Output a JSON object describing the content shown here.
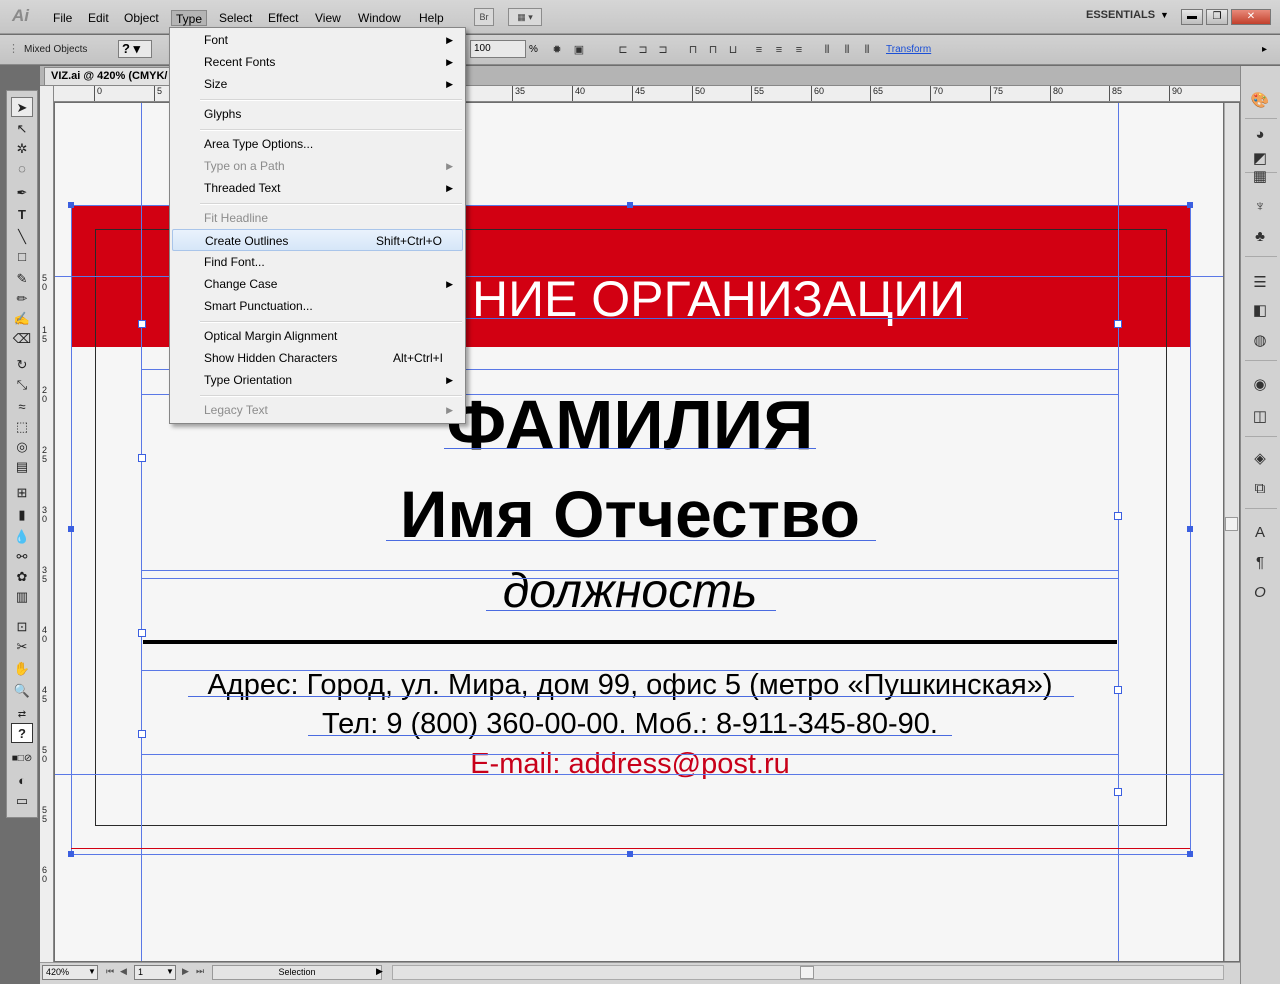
{
  "app": {
    "logo": "Ai",
    "workspace": "ESSENTIALS",
    "bridge_label": "Br"
  },
  "menubar": {
    "items": [
      "File",
      "Edit",
      "Object",
      "Type",
      "Select",
      "Effect",
      "View",
      "Window",
      "Help"
    ],
    "active": "Type"
  },
  "controlbar": {
    "selection_label": "Mixed Objects",
    "opacity_value": "100",
    "opacity_unit": "%",
    "transform_link": "Transform"
  },
  "document": {
    "tab_title": "VIZ.ai @ 420% (CMYK/"
  },
  "ruler": {
    "h_labels": [
      "0",
      "5",
      "35",
      "40",
      "45",
      "50",
      "55",
      "60",
      "65",
      "70",
      "75",
      "80",
      "85",
      "90"
    ],
    "v_labels": [
      "5",
      "0",
      "1",
      "5",
      "2",
      "0",
      "2",
      "5",
      "3",
      "0",
      "3",
      "5",
      "4",
      "0",
      "4",
      "5",
      "5",
      "0",
      "5",
      "5",
      "6",
      "0"
    ]
  },
  "type_menu": {
    "items": [
      {
        "label": "Font",
        "submenu": true
      },
      {
        "label": "Recent Fonts",
        "submenu": true
      },
      {
        "label": "Size",
        "submenu": true
      },
      {
        "label": "Glyphs"
      },
      {
        "label": "Area Type Options..."
      },
      {
        "label": "Type on a Path",
        "submenu": true,
        "disabled": true
      },
      {
        "label": "Threaded Text",
        "submenu": true
      },
      {
        "label": "Fit Headline",
        "disabled": true
      },
      {
        "label": "Create Outlines",
        "shortcut": "Shift+Ctrl+O",
        "highlighted": true
      },
      {
        "label": "Find Font..."
      },
      {
        "label": "Change Case",
        "submenu": true
      },
      {
        "label": "Smart Punctuation..."
      },
      {
        "label": "Optical Margin Alignment"
      },
      {
        "label": "Show Hidden Characters",
        "shortcut": "Alt+Ctrl+I"
      },
      {
        "label": "Type Orientation",
        "submenu": true
      },
      {
        "label": "Legacy Text",
        "submenu": true,
        "disabled": true
      }
    ]
  },
  "artwork": {
    "organization": "НИЕ ОРГАНИЗАЦИИ",
    "surname": "ФАМИЛИЯ",
    "name": "Имя Отчество",
    "position": "должность",
    "address": "Адрес: Город, ул. Мира, дом 99, офис 5 (метро «Пушкинская»)",
    "phone": "Тел: 9 (800) 360-00-00. Моб.: 8-911-345-80-90.",
    "email": "E-mail: address@post.ru",
    "colors": {
      "red_band": "#d20012",
      "email_text": "#c8001a",
      "guide": "#5a78e6"
    }
  },
  "statusbar": {
    "zoom": "420%",
    "artboard": "1",
    "tool": "Selection"
  }
}
